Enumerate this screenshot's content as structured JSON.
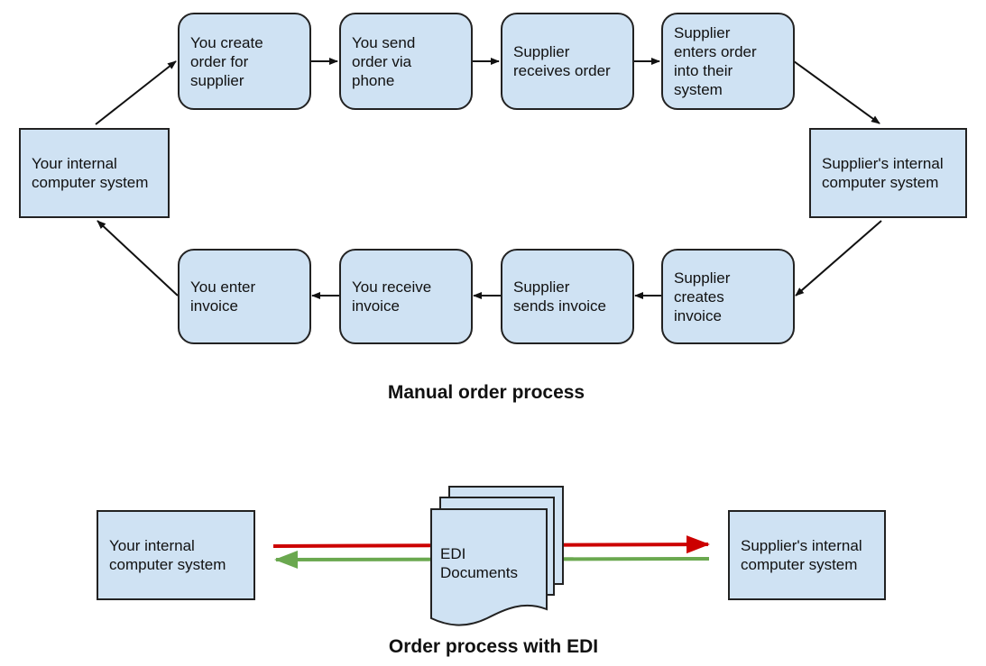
{
  "manual": {
    "title": "Manual order process",
    "your_system": "Your internal\ncomputer system",
    "supplier_system": "Supplier's internal\ncomputer system",
    "top_steps": [
      "You create\norder for\nsupplier",
      "You send\norder via\nphone",
      "Supplier\nreceives order",
      "Supplier\nenters order\ninto their\nsystem"
    ],
    "bottom_steps": [
      "You enter\ninvoice",
      "You receive\ninvoice",
      "Supplier\nsends invoice",
      "Supplier\ncreates\ninvoice"
    ]
  },
  "edi": {
    "title": "Order process with EDI",
    "your_system": "Your internal\ncomputer system",
    "supplier_system": "Supplier's internal\ncomputer system",
    "documents_label": "EDI\nDocuments",
    "outbound_color": "#cc0000",
    "inbound_color": "#6aa84f"
  },
  "colors": {
    "box_fill": "#cfe2f3",
    "stroke": "#222222"
  }
}
